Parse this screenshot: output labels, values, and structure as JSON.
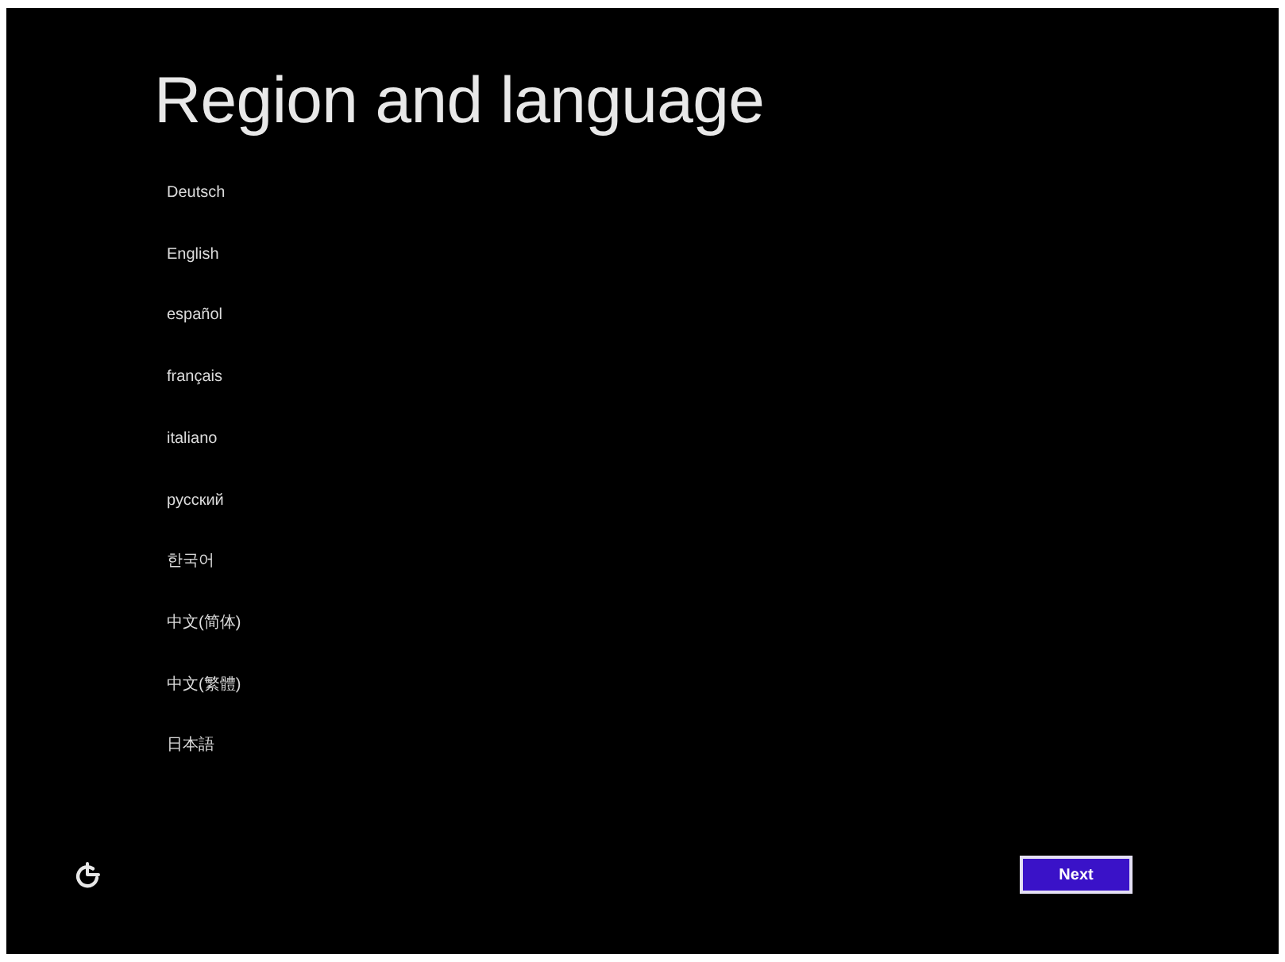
{
  "title": "Region and language",
  "languages": [
    {
      "label": "Deutsch",
      "selected": false
    },
    {
      "label": "English",
      "selected": false
    },
    {
      "label": "español",
      "selected": false
    },
    {
      "label": "français",
      "selected": false
    },
    {
      "label": "italiano",
      "selected": false
    },
    {
      "label": "русский",
      "selected": false
    },
    {
      "label": "한국어",
      "selected": false
    },
    {
      "label": "中文(简体)",
      "selected": false
    },
    {
      "label": "中文(繁體)",
      "selected": false
    },
    {
      "label": "日本語",
      "selected": false
    }
  ],
  "buttons": [
    {
      "label": "Next"
    }
  ]
}
